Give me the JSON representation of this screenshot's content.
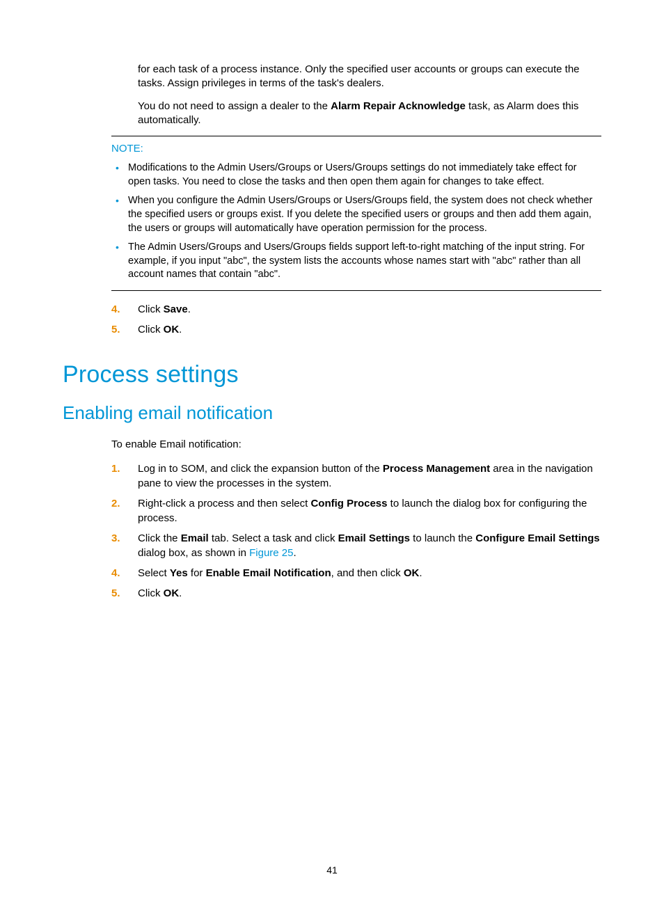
{
  "continued": {
    "p1": "for each task of a process instance. Only the specified user accounts or groups can execute the tasks. Assign privileges in terms of the task's dealers.",
    "p2_pre": "You do not need to assign a dealer to the ",
    "p2_bold": "Alarm Repair Acknowledge",
    "p2_post": " task, as Alarm does this automatically."
  },
  "note": {
    "label": "NOTE:",
    "items": [
      "Modifications to the Admin Users/Groups or Users/Groups settings do not immediately take effect for open tasks. You need to close the tasks and then open them again for changes to take effect.",
      "When you configure the Admin Users/Groups or Users/Groups field, the system does not check whether the specified users or groups exist. If you delete the specified users or groups and then add them again, the users or groups will automatically have operation permission for the process.",
      "The Admin Users/Groups and Users/Groups fields support left-to-right matching of the input string. For example, if you input \"abc\", the system lists the accounts whose names start with \"abc\" rather than all account names that contain \"abc\"."
    ]
  },
  "post_note_steps": {
    "s4": {
      "num": "4.",
      "pre": "Click ",
      "bold": "Save",
      "post": "."
    },
    "s5": {
      "num": "5.",
      "pre": "Click ",
      "bold": "OK",
      "post": "."
    }
  },
  "h1": "Process settings",
  "h2": "Enabling email notification",
  "lead": "To enable Email notification:",
  "enable_steps": {
    "s1": {
      "num": "1.",
      "pre": "Log in to SOM, and click the expansion button of the ",
      "b1": "Process Management",
      "post": " area in the navigation pane to view the processes in the system."
    },
    "s2": {
      "num": "2.",
      "pre": "Right-click a process and then select ",
      "b1": "Config Process",
      "post": " to launch the dialog box for configuring the process."
    },
    "s3": {
      "num": "3.",
      "t1": "Click the ",
      "b1": "Email",
      "t2": " tab. Select a task and click ",
      "b2": "Email Settings",
      "t3": " to launch the ",
      "b3": "Configure Email Settings",
      "t4": " dialog box, as shown in ",
      "link": "Figure 25",
      "t5": "."
    },
    "s4": {
      "num": "4.",
      "t1": "Select ",
      "b1": "Yes",
      "t2": " for ",
      "b2": "Enable Email Notification",
      "t3": ", and then click ",
      "b3": "OK",
      "t4": "."
    },
    "s5": {
      "num": "5.",
      "pre": "Click ",
      "bold": "OK",
      "post": "."
    }
  },
  "page_number": "41"
}
